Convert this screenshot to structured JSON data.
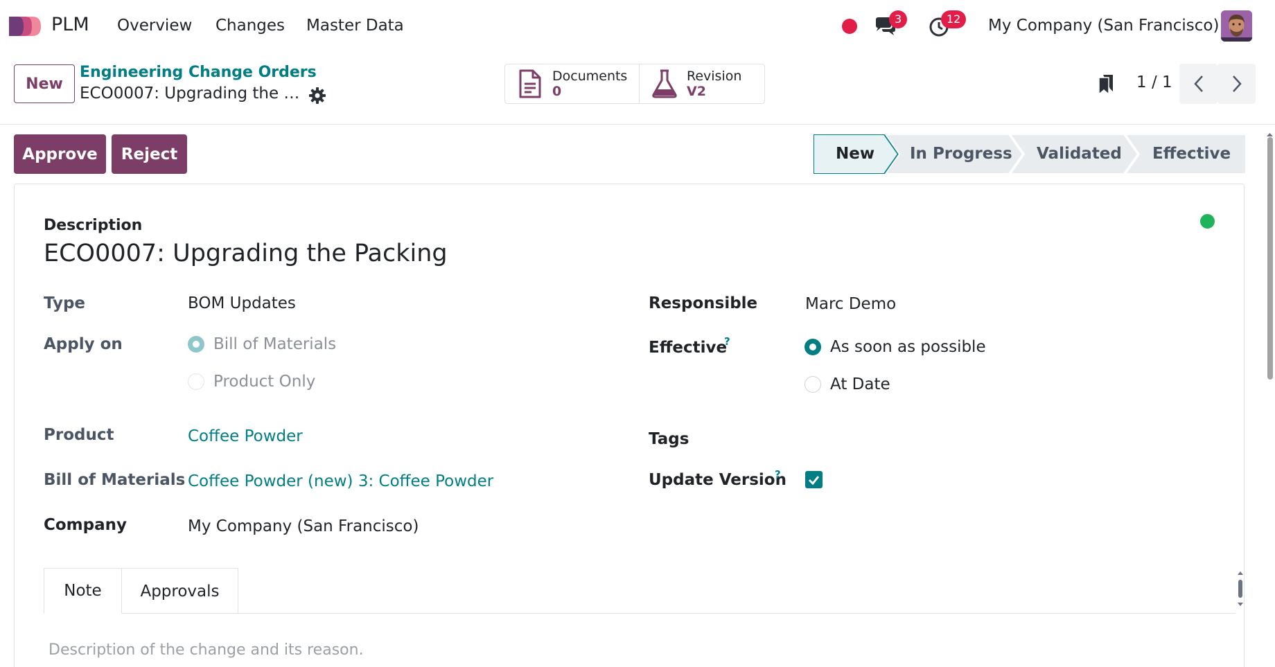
{
  "navbar": {
    "app_name": "PLM",
    "menu": [
      "Overview",
      "Changes",
      "Master Data"
    ],
    "messages_count": "3",
    "activities_count": "12",
    "company": "My Company (San Francisco)"
  },
  "control_panel": {
    "new_label": "New",
    "breadcrumb_parent": "Engineering Change Orders",
    "breadcrumb_current": "ECO0007: Upgrading the P...",
    "smart_buttons": [
      {
        "label": "Documents",
        "value": "0",
        "icon": "document-icon"
      },
      {
        "label": "Revision",
        "value": "V2",
        "icon": "flask-icon"
      }
    ],
    "pager": "1 / 1"
  },
  "actions": {
    "approve": "Approve",
    "reject": "Reject"
  },
  "stages": [
    "New",
    "In Progress",
    "Validated",
    "Effective"
  ],
  "active_stage": "New",
  "form": {
    "description_label": "Description",
    "title": "ECO0007: Upgrading the Packing",
    "type_label": "Type",
    "type_value": "BOM Updates",
    "apply_on_label": "Apply on",
    "apply_on_options": [
      "Bill of Materials",
      "Product Only"
    ],
    "product_label": "Product",
    "product_value": "Coffee Powder",
    "bom_label": "Bill of Materials",
    "bom_value": "Coffee Powder (new) 3: Coffee Powder",
    "company_label": "Company",
    "company_value": "My Company (San Francisco)",
    "responsible_label": "Responsible",
    "responsible_value": "Marc Demo",
    "effective_label": "Effective",
    "effective_help": "?",
    "effective_options": [
      "As soon as possible",
      "At Date"
    ],
    "tags_label": "Tags",
    "update_version_label": "Update Version",
    "update_version_help": "?",
    "update_version_checked": true
  },
  "tabs": [
    "Note",
    "Approvals"
  ],
  "note_placeholder": "Description of the change and its reason.",
  "colors": {
    "brand": "#7c3e66",
    "link": "#017e84",
    "badge": "#e11d48",
    "status_ok": "#21b35b"
  }
}
